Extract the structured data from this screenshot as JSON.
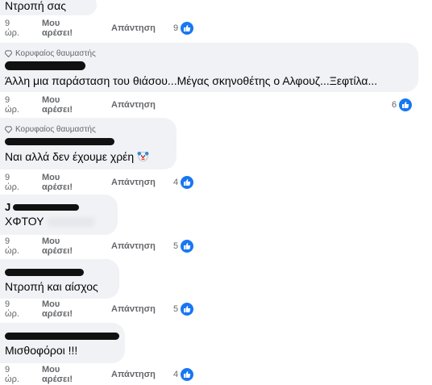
{
  "labels": {
    "top_fan": "Κορυφαίος θαυμαστής",
    "like": "Μου αρέσει!",
    "reply": "Απάντηση"
  },
  "icons": {
    "top_fan": "gem-icon",
    "like_reaction": "thumbs-up-icon"
  },
  "colors": {
    "bubble": "#f0f2f5",
    "like_blue": "#1877f2",
    "meta": "#65676b"
  },
  "comments": [
    {
      "text": "Ντροπή σας",
      "time": "9 ώρ.",
      "reactions": "9"
    },
    {
      "text": "Άλλη μια παράσταση του θιάσου...Μέγας σκηνοθέτης ο Αλφουζ...Ξεφτίλα...",
      "time": "9 ώρ.",
      "reactions": "6"
    },
    {
      "text": "Ναι αλλά δεν έχουμε χρέη",
      "emoji": "clown-face-emoji",
      "time": "9 ώρ.",
      "reactions": "4"
    },
    {
      "author_partial": "J",
      "text": "ΧΦΤΟΥ",
      "time": "9 ώρ.",
      "reactions": "5"
    },
    {
      "text": "Ντροπή και αίσχος",
      "time": "9 ώρ.",
      "reactions": "5"
    },
    {
      "text": "Μισθοφόροι !!!",
      "time": "9 ώρ.",
      "reactions": "4"
    }
  ]
}
